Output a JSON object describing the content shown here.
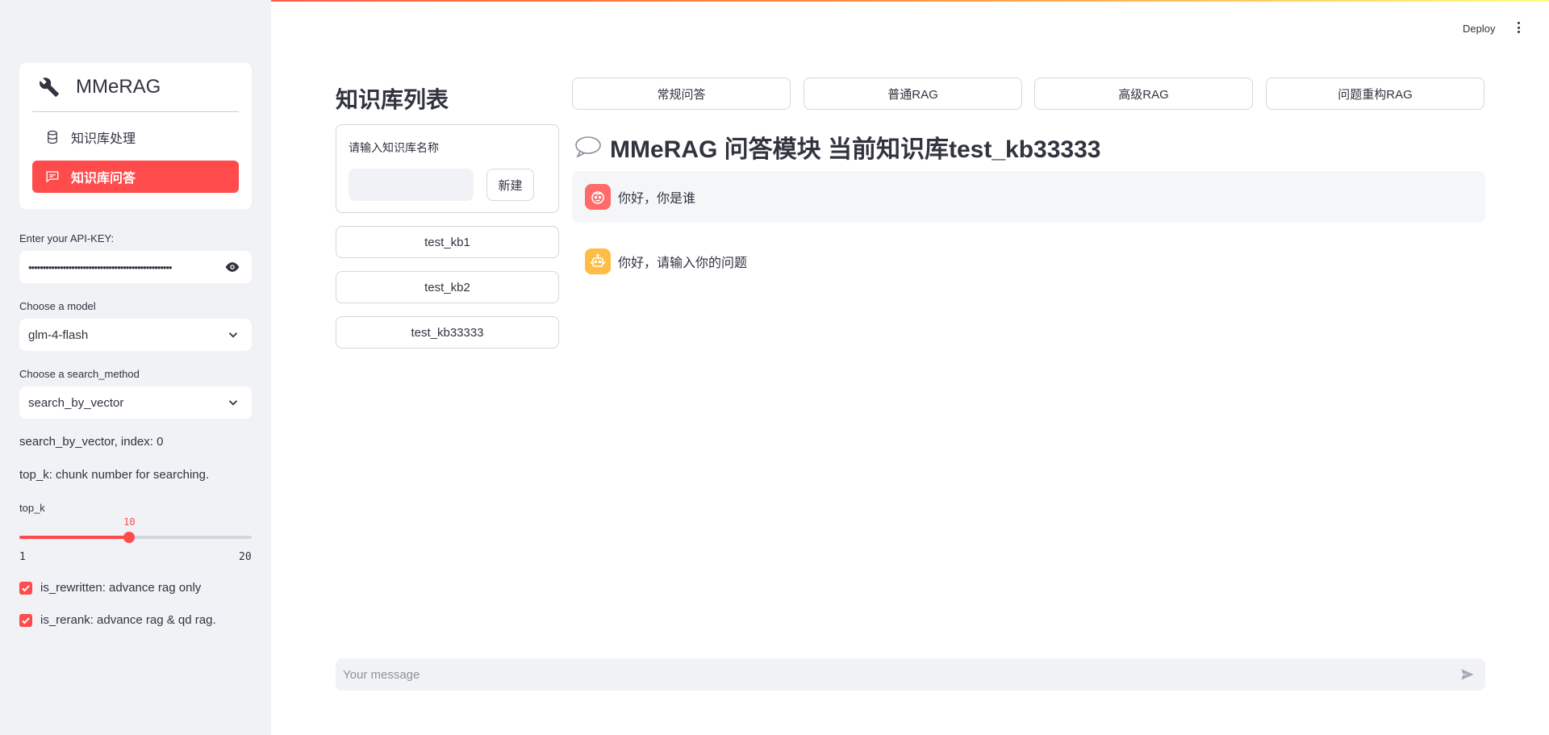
{
  "app": {
    "deploy_label": "Deploy",
    "menu_icon": "more-vertical-icon"
  },
  "sidebar": {
    "menu": {
      "title": "MMeRAG",
      "title_icon": "wrench-icon",
      "items": [
        {
          "label": "知识库处理",
          "icon": "database-icon",
          "active": false
        },
        {
          "label": "知识库问答",
          "icon": "chat-icon",
          "active": true
        }
      ]
    },
    "api_key": {
      "label": "Enter your API-KEY:",
      "value": "••••••••••••••••••••••••••••••••••••••••••••••••••"
    },
    "model": {
      "label": "Choose a model",
      "selected": "glm-4-flash"
    },
    "search_method": {
      "label": "Choose a search_method",
      "selected": "search_by_vector"
    },
    "info_text": "search_by_vector, index: 0",
    "top_k_help": "top_k: chunk number for searching.",
    "top_k": {
      "label": "top_k",
      "value": 10,
      "min": 1,
      "max": 20,
      "value_label": "10",
      "min_label": "1",
      "max_label": "20"
    },
    "checkboxes": [
      {
        "label": "is_rewritten: advance rag only",
        "checked": true
      },
      {
        "label": "is_rerank: advance rag & qd rag.",
        "checked": true
      }
    ]
  },
  "kb": {
    "title": "知识库列表",
    "input_label": "请输入知识库名称",
    "input_value": "",
    "new_button": "新建",
    "items": [
      "test_kb1",
      "test_kb2",
      "test_kb33333"
    ]
  },
  "modes": [
    "常规问答",
    "普通RAG",
    "高级RAG",
    "问题重构RAG"
  ],
  "chat": {
    "title": "MMeRAG 问答模块 当前知识库test_kb33333",
    "title_icon": "speech-bubble-icon",
    "messages": [
      {
        "role": "user",
        "text": "你好，你是谁"
      },
      {
        "role": "assistant",
        "text": "你好，请输入你的问题"
      }
    ],
    "input_placeholder": "Your message"
  },
  "colors": {
    "accent": "#ff4b4b",
    "sidebar_bg": "#f0f2f6",
    "user_avatar": "#ff6b6b",
    "bot_avatar": "#ffbd45"
  }
}
